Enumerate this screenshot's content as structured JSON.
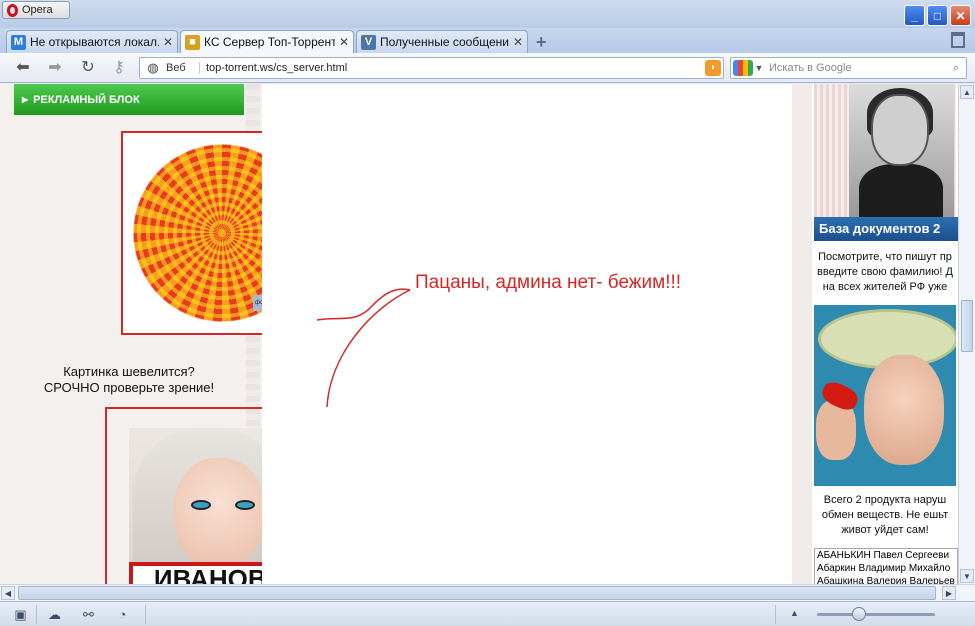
{
  "window": {
    "menu_button": "Opera"
  },
  "tabs": [
    {
      "label": "Не открываются локал...",
      "favicon": "M",
      "favicon_color": "#2f7fd6",
      "active": false
    },
    {
      "label": "КС Сервер Топ-Торрент",
      "favicon": "cube",
      "favicon_color": "#d9a020",
      "active": true
    },
    {
      "label": "Полученные сообщени...",
      "favicon": "V",
      "favicon_color": "#4a76a8",
      "active": false
    }
  ],
  "addressbar": {
    "web_label": "Веб",
    "url": "top-torrent.ws/cs_server.html"
  },
  "search": {
    "placeholder": "Искать в Google"
  },
  "page": {
    "ad_block_header": "РЕКЛАМНЫЙ БЛОК",
    "illusion_tag": "фотоэффекты.рф",
    "caption_line1": "Картинка шевелится?",
    "caption_line2": "СРОЧНО проверьте зрение!",
    "nameplate": "ИВАНОВА",
    "meme_text": "Пацаны, админа нет- бежим!!!",
    "right": {
      "banner": "База документов 2",
      "text1": [
        "Посмотрите, что пишут пр",
        "введите свою фамилию! Д",
        "на всех жителей РФ уже"
      ],
      "text2": [
        "Всего 2 продукта наруш",
        "обмен веществ. Не ешьт",
        "живот уйдет сам!"
      ],
      "list": [
        "АБАНЬКИН Павел Сергееви",
        "Абаркин Владимир Михайло",
        "Абашкина Валерия Валерьев"
      ]
    }
  },
  "colors": {
    "accent_red": "#d42828",
    "ad_green": "#2ea52e",
    "banner_blue": "#1f5a9c"
  }
}
